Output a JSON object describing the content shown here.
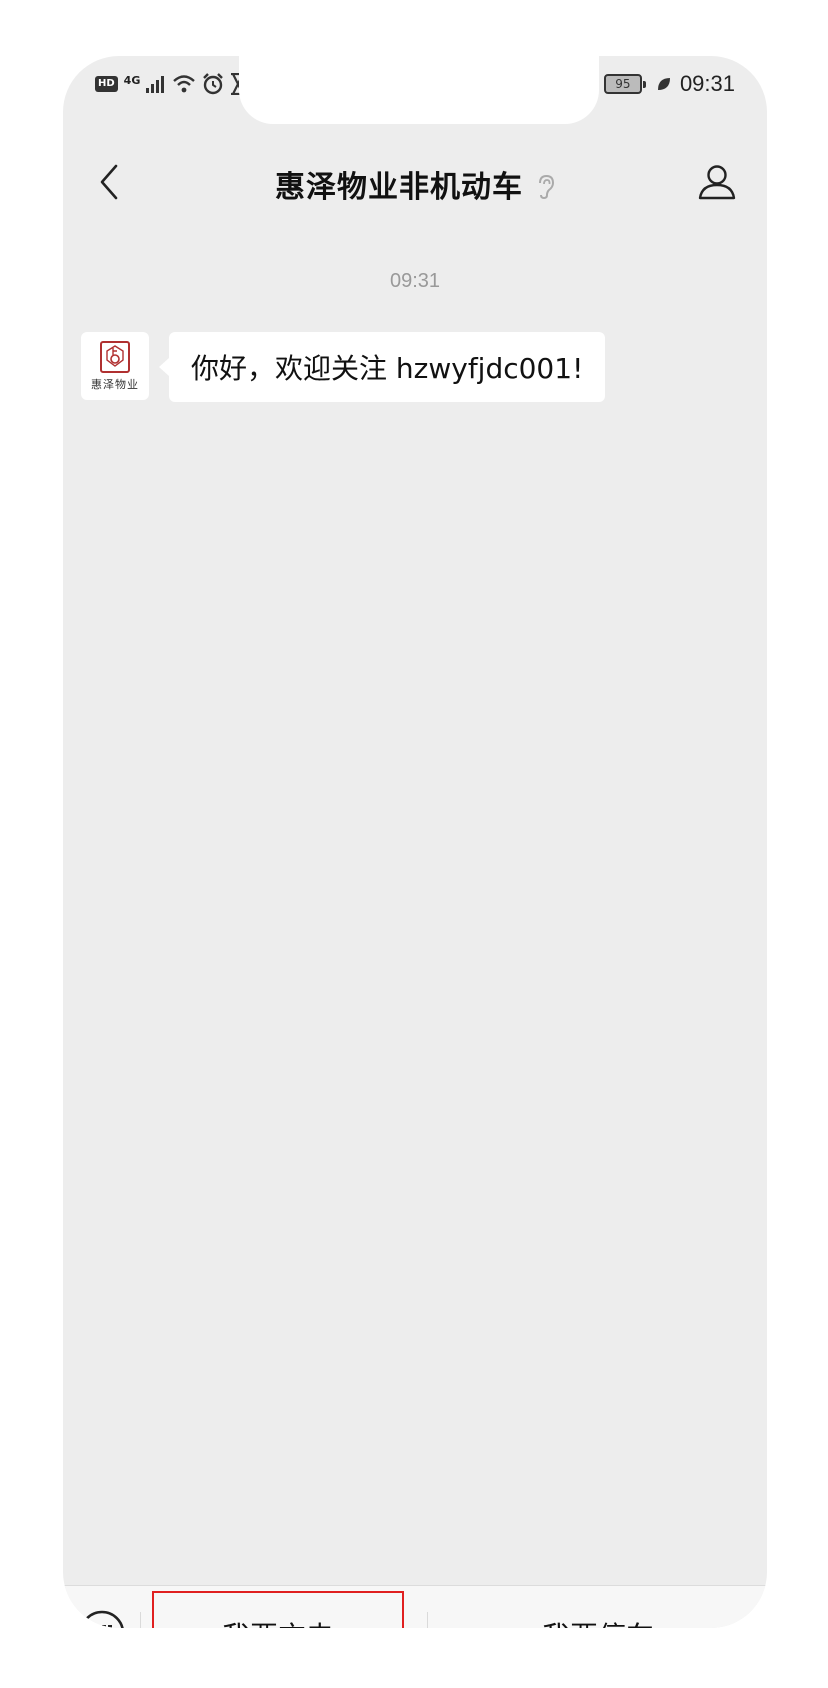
{
  "status_bar": {
    "hd": "HD",
    "network": "4G",
    "battery": "95",
    "time": "09:31"
  },
  "nav": {
    "title": "惠泽物业非机动车",
    "icons": [
      "back-icon",
      "ear-icon",
      "profile-icon"
    ]
  },
  "chat": {
    "timestamp": "09:31",
    "messages": [
      {
        "sender_caption": "惠泽物业",
        "text": "你好，欢迎关注 hzwyfjdc001!"
      }
    ]
  },
  "menu": {
    "items": [
      {
        "label": "我要充电",
        "highlighted": true
      },
      {
        "label": "我要停车",
        "highlighted": false
      }
    ]
  },
  "colors": {
    "background": "#ededed",
    "bubble": "#ffffff",
    "highlight_border": "#e02020",
    "seal": "#b03030"
  }
}
